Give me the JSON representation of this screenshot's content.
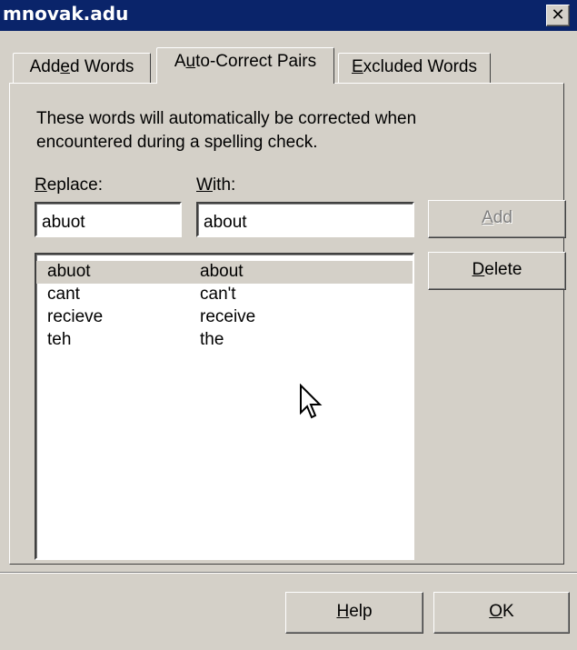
{
  "window": {
    "title": "mnovak.adu",
    "close_label": "✕"
  },
  "tabs": [
    {
      "pre": "Add",
      "key": "e",
      "post": "d Words",
      "active": false
    },
    {
      "pre": "A",
      "key": "u",
      "post": "to-Correct Pairs",
      "active": true
    },
    {
      "pre": "",
      "key": "E",
      "post": "xcluded Words",
      "active": false
    }
  ],
  "description": "These words will automatically be corrected when encountered during a spelling check.",
  "replace": {
    "label_key": "R",
    "label_rest": "eplace:",
    "value": "abuot"
  },
  "with": {
    "label_key": "W",
    "label_rest": "ith:",
    "value": "about"
  },
  "buttons": {
    "add": {
      "key": "A",
      "rest": "dd",
      "enabled": false
    },
    "delete": {
      "key": "D",
      "rest": "elete"
    },
    "help": {
      "key": "H",
      "rest": "elp"
    },
    "ok": {
      "key": "O",
      "rest": "K"
    }
  },
  "pairs": [
    {
      "word": "abuot",
      "correction": "about",
      "selected": true
    },
    {
      "word": "cant",
      "correction": "can't",
      "selected": false
    },
    {
      "word": "recieve",
      "correction": "receive",
      "selected": false
    },
    {
      "word": "teh",
      "correction": "the",
      "selected": false
    }
  ],
  "icons": {
    "close": "close-icon",
    "cursor": "mouse-pointer-icon"
  },
  "colors": {
    "titlebar": "#0a246a",
    "face": "#d4d0c8",
    "selection": "#d4d0c8"
  }
}
